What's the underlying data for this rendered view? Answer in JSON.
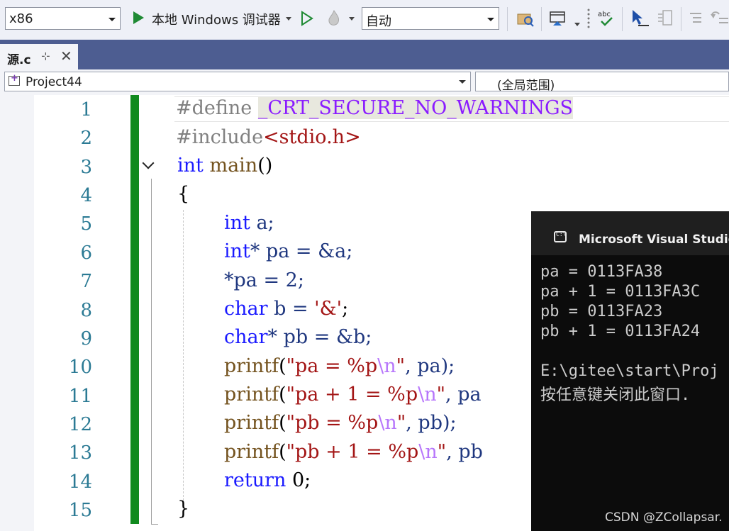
{
  "toolbar": {
    "platform": "x86",
    "run_target": "本地 Windows 调试器",
    "solution_config": "自动"
  },
  "tab": {
    "filename": "源.c",
    "pin_glyph": "⊹",
    "close_glyph": "✕"
  },
  "navbar": {
    "project": "Project44",
    "scope": "(全局范围)"
  },
  "line_numbers": [
    "1",
    "2",
    "3",
    "4",
    "5",
    "6",
    "7",
    "8",
    "9",
    "10",
    "11",
    "12",
    "13",
    "14",
    "15"
  ],
  "code": {
    "l1_directive": "#define",
    "l1_macro": "_CRT_SECURE_NO_WARNINGS",
    "l2_directive": "#include",
    "l2_header": "<stdio.h>",
    "l3_type": "int",
    "l3_func": "main",
    "l3_parens": "()",
    "l4": "{",
    "l5_type": "int",
    "l5_rest": " a;",
    "l6_type": "int",
    "l6_rest": "* pa = &a;",
    "l7": "*pa = 2;",
    "l8_type": "char",
    "l8_rest": " b = ",
    "l8_char": "'&'",
    "l8_end": ";",
    "l9_type": "char",
    "l9_rest": "* pb = &b;",
    "l10_fn": "printf",
    "l10_open": "(",
    "l10_str1": "\"pa = %p",
    "l10_esc": "\\n",
    "l10_str2": "\"",
    "l10_rest": ", pa);",
    "l11_fn": "printf",
    "l11_open": "(",
    "l11_str1": "\"pa + 1 = %p",
    "l11_esc": "\\n",
    "l11_str2": "\"",
    "l11_rest": ", pa",
    "l12_fn": "printf",
    "l12_open": "(",
    "l12_str1": "\"pb = %p",
    "l12_esc": "\\n",
    "l12_str2": "\"",
    "l12_rest": ", pb);",
    "l13_fn": "printf",
    "l13_open": "(",
    "l13_str1": "\"pb + 1 = %p",
    "l13_esc": "\\n",
    "l13_str2": "\"",
    "l13_rest": ", pb",
    "l14_kw": "return",
    "l14_rest": " 0;",
    "l15": "}"
  },
  "console": {
    "title": "Microsoft Visual Studio 调",
    "lines": [
      "pa = 0113FA38",
      "pa + 1 = 0113FA3C",
      "pb = 0113FA23",
      "pb + 1 = 0113FA24",
      "",
      "E:\\gitee\\start\\Proj",
      "按任意键关闭此窗口."
    ]
  },
  "watermark": "CSDN @ZCollapsar.",
  "colors": {
    "keyword": "#1a1aff",
    "string": "#a31515",
    "preprocessor": "#808080",
    "change_bar": "#118a1e",
    "tab_strip": "#4d5d91"
  }
}
